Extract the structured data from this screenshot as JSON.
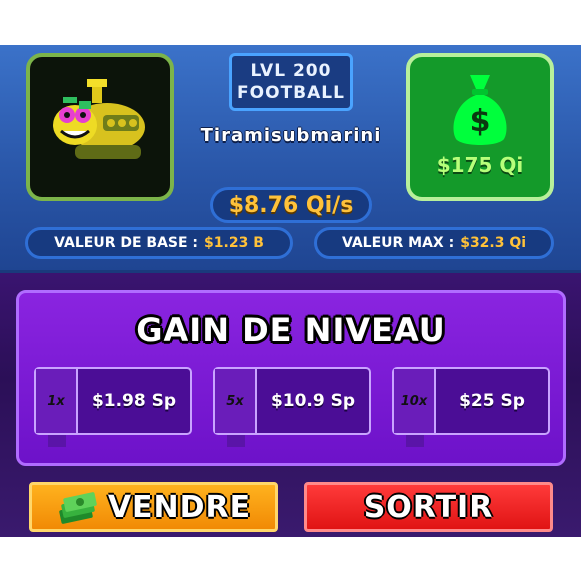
{
  "pet": {
    "level": "LVL 200",
    "mutation": "FOOTBALL",
    "name": "Tiramisubmarini",
    "rate": "$8.76 Qi/s"
  },
  "money": {
    "icon": "money-bag-icon",
    "amount": "$175 Qi"
  },
  "stats": {
    "base_label": "VALEUR DE BASE :",
    "base_value": "$1.23 B",
    "max_label": "VALEUR MAX :",
    "max_value": "$32.3 Qi"
  },
  "level_up": {
    "title": "GAIN DE NIVEAU",
    "options": [
      {
        "multiplier": "1x",
        "price": "$1.98 Sp"
      },
      {
        "multiplier": "5x",
        "price": "$10.9 Sp"
      },
      {
        "multiplier": "10x",
        "price": "$25 Sp"
      }
    ]
  },
  "actions": {
    "sell_label": "VENDRE",
    "sell_icon": "cash-stack-icon",
    "exit_label": "SORTIR"
  },
  "colors": {
    "accent_gold": "#ffc23a",
    "panel_blue": "#2a57a9",
    "panel_purple": "#7a1bd6",
    "money_green": "#149a2a",
    "sell_orange": "#f18a05",
    "exit_red": "#e01414"
  }
}
